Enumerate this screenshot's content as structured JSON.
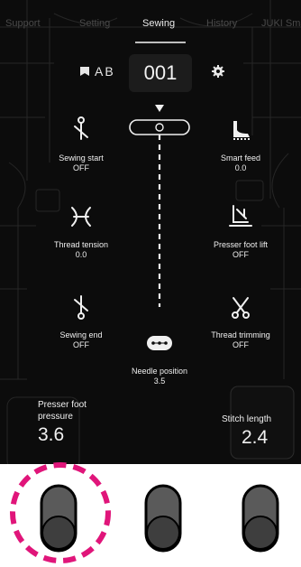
{
  "tabs": [
    {
      "label": "Support"
    },
    {
      "label": "Setting"
    },
    {
      "label": "Sewing"
    },
    {
      "label": "History"
    },
    {
      "label": "JUKI Smart"
    }
  ],
  "pattern": {
    "label": "AB",
    "number": "001"
  },
  "items": {
    "sewing_start": {
      "label": "Sewing start",
      "value": "OFF",
      "icon": "sewing-start-icon"
    },
    "smart_feed": {
      "label": "Smart feed",
      "value": "0.0",
      "icon": "smart-feed-icon"
    },
    "thread_tension": {
      "label": "Thread tension",
      "value": "0.0",
      "icon": "thread-tension-icon"
    },
    "presser_foot_lift": {
      "label": "Presser foot lift",
      "value": "OFF",
      "icon": "presser-foot-lift-icon"
    },
    "sewing_end": {
      "label": "Sewing end",
      "value": "OFF",
      "icon": "sewing-end-icon"
    },
    "thread_trimming": {
      "label": "Thread trimming",
      "value": "OFF",
      "icon": "scissors-icon"
    },
    "needle_position": {
      "label": "Needle position",
      "value": "3.5",
      "icon": "needle-position-icon"
    }
  },
  "params": {
    "presser_foot_pressure": {
      "label_line1": "Presser foot",
      "label_line2": "pressure",
      "value": "3.6"
    },
    "stitch_length": {
      "label": "Stitch length",
      "value": "2.4"
    }
  },
  "colors": {
    "screen_bg": "#0c0c0c",
    "text": "#f0f0f0",
    "highlight": "#e0157a",
    "knob": "#5a5a5a"
  }
}
